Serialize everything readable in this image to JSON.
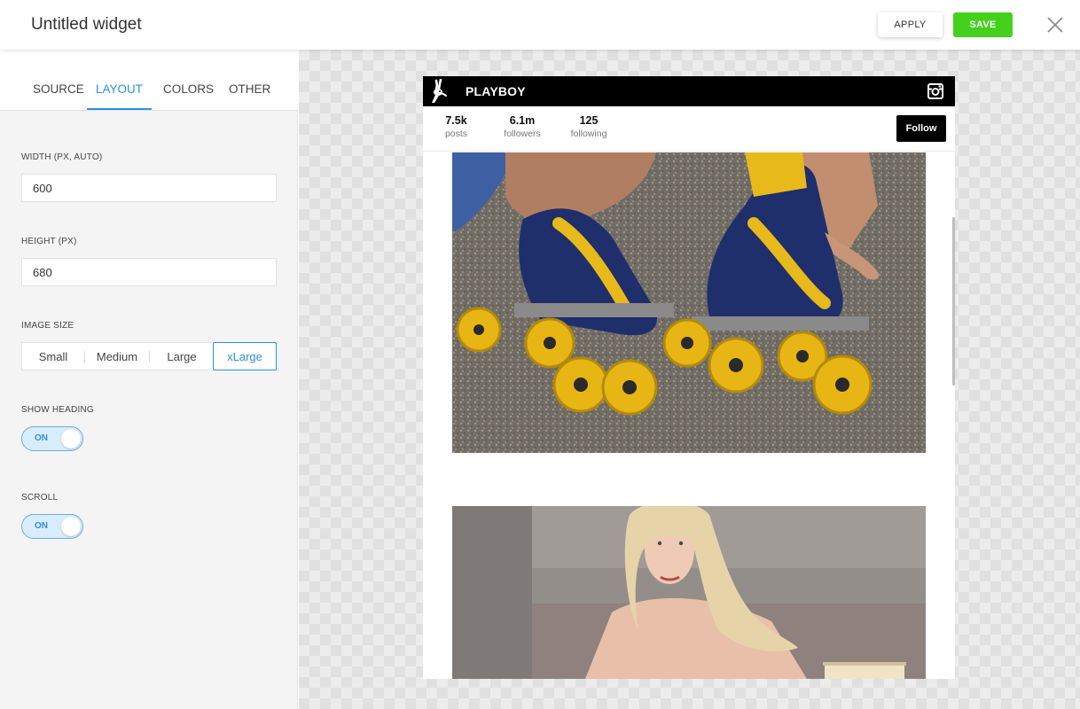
{
  "header": {
    "title": "Untitled widget",
    "apply_label": "APPLY",
    "save_label": "SAVE"
  },
  "sidebar": {
    "tabs": [
      {
        "label": "SOURCE",
        "active": false
      },
      {
        "label": "LAYOUT",
        "active": true
      },
      {
        "label": "COLORS",
        "active": false
      },
      {
        "label": "OTHER",
        "active": false
      }
    ],
    "width": {
      "label": "WIDTH (PX, AUTO)",
      "value": "600"
    },
    "height": {
      "label": "HEIGHT (PX)",
      "value": "680"
    },
    "image_size": {
      "label": "IMAGE SIZE",
      "options": [
        "Small",
        "Medium",
        "Large",
        "xLarge"
      ],
      "selected": "xLarge"
    },
    "show_heading": {
      "label": "SHOW HEADING",
      "state": "ON"
    },
    "scroll": {
      "label": "SCROLL",
      "state": "ON"
    }
  },
  "preview": {
    "account_name": "PLAYBOY",
    "stats": [
      {
        "value": "7.5k",
        "label": "posts"
      },
      {
        "value": "6.1m",
        "label": "followers"
      },
      {
        "value": "125",
        "label": "following"
      }
    ],
    "follow_label": "Follow"
  },
  "colors": {
    "accent": "#2b90e0",
    "save_green": "#43d11b",
    "widget_header": "#000000"
  },
  "icons": [
    "close-icon",
    "playboy-bunny-logo",
    "instagram-icon"
  ]
}
